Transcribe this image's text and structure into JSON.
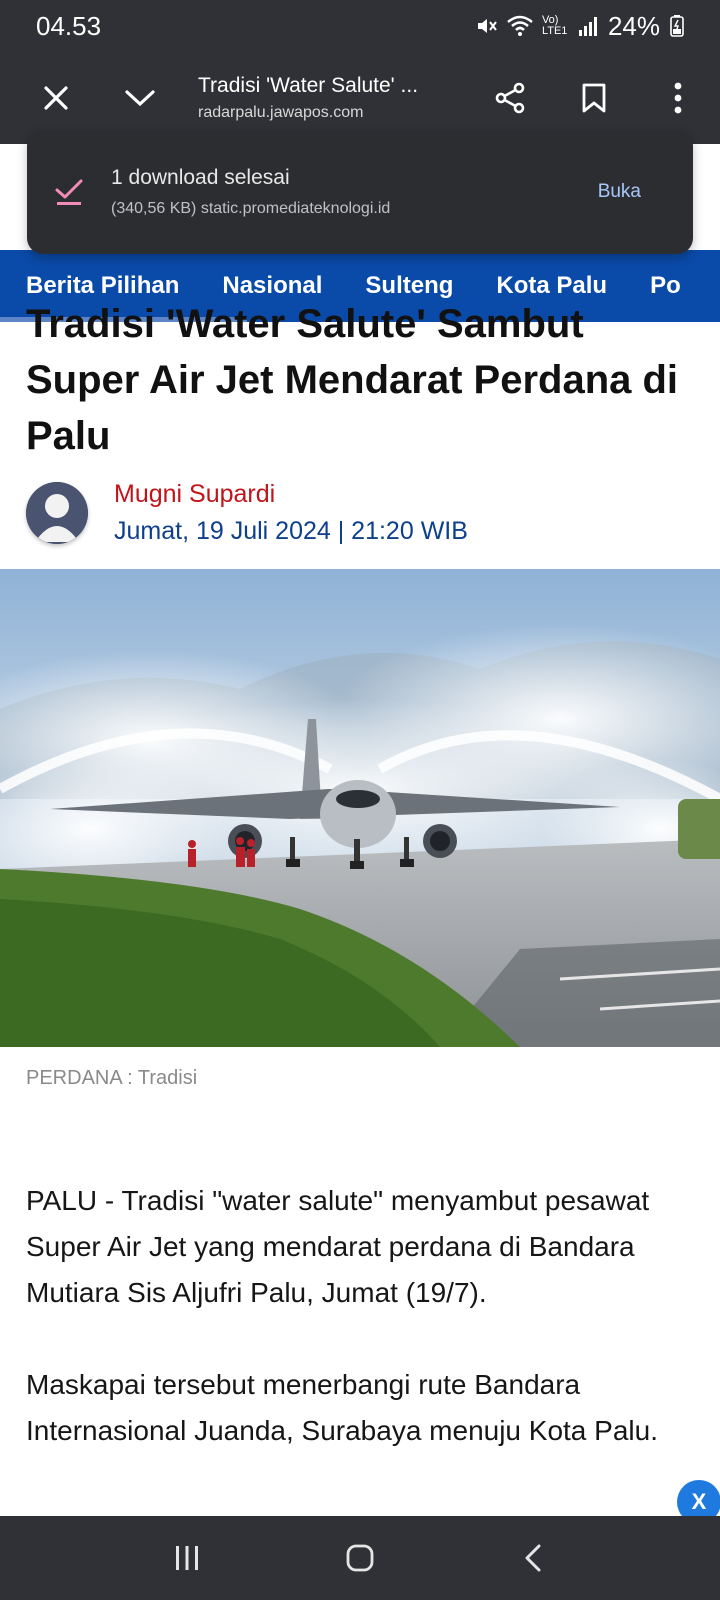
{
  "status_bar": {
    "time": "04.53",
    "network_label": "Vo) LTE1",
    "battery": "24%"
  },
  "toolbar": {
    "page_title": "Tradisi 'Water Salute' ...",
    "url": "radarpalu.jawapos.com"
  },
  "download_snackbar": {
    "title": "1 download selesai",
    "detail": "(340,56 KB) static.promediateknologi.id",
    "action": "Buka"
  },
  "category_nav": {
    "items": [
      "Berita Pilihan",
      "Nasional",
      "Sulteng",
      "Kota Palu",
      "Po"
    ]
  },
  "article": {
    "title": "Tradisi 'Water Salute' Sambut Super Air Jet Mendarat Perdana di Palu",
    "author": "Mugni Supardi",
    "date": "Jumat, 19 Juli 2024 | 21:20 WIB",
    "caption": "PERDANA : Tradisi",
    "paragraphs": [
      "PALU - Tradisi \"water salute\" menyambut pesawat Super Air Jet yang mendarat perdana di Bandara Mutiara Sis Aljufri Palu, Jumat (19/7).",
      "Maskapai tersebut menerbangi rute Bandara Internasional Juanda, Surabaya menuju Kota Palu."
    ]
  },
  "floating_close": {
    "label": "X"
  },
  "colors": {
    "status_bg": "#2f3136",
    "nav_blue": "#0a4aa8",
    "author_red": "#c0141b",
    "date_blue": "#0d3f8c",
    "check_pink": "#f28cb8",
    "action_blue": "#a8c7fa"
  },
  "icons": {
    "close": "close-icon",
    "expand": "chevron-down-icon",
    "share": "share-icon",
    "bookmark": "bookmark-icon",
    "menu": "more-vert-icon",
    "download_done": "download-done-icon",
    "nav_recents": "recents-icon",
    "nav_home": "home-icon",
    "nav_back": "back-icon"
  }
}
